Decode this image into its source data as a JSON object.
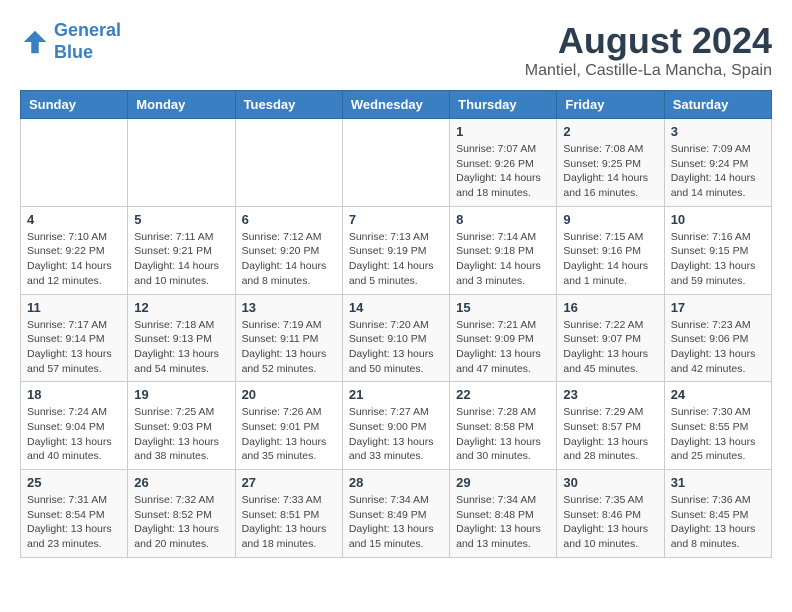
{
  "header": {
    "logo_line1": "General",
    "logo_line2": "Blue",
    "title": "August 2024",
    "subtitle": "Mantiel, Castille-La Mancha, Spain"
  },
  "weekdays": [
    "Sunday",
    "Monday",
    "Tuesday",
    "Wednesday",
    "Thursday",
    "Friday",
    "Saturday"
  ],
  "weeks": [
    [
      {
        "day": "",
        "info": ""
      },
      {
        "day": "",
        "info": ""
      },
      {
        "day": "",
        "info": ""
      },
      {
        "day": "",
        "info": ""
      },
      {
        "day": "1",
        "info": "Sunrise: 7:07 AM\nSunset: 9:26 PM\nDaylight: 14 hours\nand 18 minutes."
      },
      {
        "day": "2",
        "info": "Sunrise: 7:08 AM\nSunset: 9:25 PM\nDaylight: 14 hours\nand 16 minutes."
      },
      {
        "day": "3",
        "info": "Sunrise: 7:09 AM\nSunset: 9:24 PM\nDaylight: 14 hours\nand 14 minutes."
      }
    ],
    [
      {
        "day": "4",
        "info": "Sunrise: 7:10 AM\nSunset: 9:22 PM\nDaylight: 14 hours\nand 12 minutes."
      },
      {
        "day": "5",
        "info": "Sunrise: 7:11 AM\nSunset: 9:21 PM\nDaylight: 14 hours\nand 10 minutes."
      },
      {
        "day": "6",
        "info": "Sunrise: 7:12 AM\nSunset: 9:20 PM\nDaylight: 14 hours\nand 8 minutes."
      },
      {
        "day": "7",
        "info": "Sunrise: 7:13 AM\nSunset: 9:19 PM\nDaylight: 14 hours\nand 5 minutes."
      },
      {
        "day": "8",
        "info": "Sunrise: 7:14 AM\nSunset: 9:18 PM\nDaylight: 14 hours\nand 3 minutes."
      },
      {
        "day": "9",
        "info": "Sunrise: 7:15 AM\nSunset: 9:16 PM\nDaylight: 14 hours\nand 1 minute."
      },
      {
        "day": "10",
        "info": "Sunrise: 7:16 AM\nSunset: 9:15 PM\nDaylight: 13 hours\nand 59 minutes."
      }
    ],
    [
      {
        "day": "11",
        "info": "Sunrise: 7:17 AM\nSunset: 9:14 PM\nDaylight: 13 hours\nand 57 minutes."
      },
      {
        "day": "12",
        "info": "Sunrise: 7:18 AM\nSunset: 9:13 PM\nDaylight: 13 hours\nand 54 minutes."
      },
      {
        "day": "13",
        "info": "Sunrise: 7:19 AM\nSunset: 9:11 PM\nDaylight: 13 hours\nand 52 minutes."
      },
      {
        "day": "14",
        "info": "Sunrise: 7:20 AM\nSunset: 9:10 PM\nDaylight: 13 hours\nand 50 minutes."
      },
      {
        "day": "15",
        "info": "Sunrise: 7:21 AM\nSunset: 9:09 PM\nDaylight: 13 hours\nand 47 minutes."
      },
      {
        "day": "16",
        "info": "Sunrise: 7:22 AM\nSunset: 9:07 PM\nDaylight: 13 hours\nand 45 minutes."
      },
      {
        "day": "17",
        "info": "Sunrise: 7:23 AM\nSunset: 9:06 PM\nDaylight: 13 hours\nand 42 minutes."
      }
    ],
    [
      {
        "day": "18",
        "info": "Sunrise: 7:24 AM\nSunset: 9:04 PM\nDaylight: 13 hours\nand 40 minutes."
      },
      {
        "day": "19",
        "info": "Sunrise: 7:25 AM\nSunset: 9:03 PM\nDaylight: 13 hours\nand 38 minutes."
      },
      {
        "day": "20",
        "info": "Sunrise: 7:26 AM\nSunset: 9:01 PM\nDaylight: 13 hours\nand 35 minutes."
      },
      {
        "day": "21",
        "info": "Sunrise: 7:27 AM\nSunset: 9:00 PM\nDaylight: 13 hours\nand 33 minutes."
      },
      {
        "day": "22",
        "info": "Sunrise: 7:28 AM\nSunset: 8:58 PM\nDaylight: 13 hours\nand 30 minutes."
      },
      {
        "day": "23",
        "info": "Sunrise: 7:29 AM\nSunset: 8:57 PM\nDaylight: 13 hours\nand 28 minutes."
      },
      {
        "day": "24",
        "info": "Sunrise: 7:30 AM\nSunset: 8:55 PM\nDaylight: 13 hours\nand 25 minutes."
      }
    ],
    [
      {
        "day": "25",
        "info": "Sunrise: 7:31 AM\nSunset: 8:54 PM\nDaylight: 13 hours\nand 23 minutes."
      },
      {
        "day": "26",
        "info": "Sunrise: 7:32 AM\nSunset: 8:52 PM\nDaylight: 13 hours\nand 20 minutes."
      },
      {
        "day": "27",
        "info": "Sunrise: 7:33 AM\nSunset: 8:51 PM\nDaylight: 13 hours\nand 18 minutes."
      },
      {
        "day": "28",
        "info": "Sunrise: 7:34 AM\nSunset: 8:49 PM\nDaylight: 13 hours\nand 15 minutes."
      },
      {
        "day": "29",
        "info": "Sunrise: 7:34 AM\nSunset: 8:48 PM\nDaylight: 13 hours\nand 13 minutes."
      },
      {
        "day": "30",
        "info": "Sunrise: 7:35 AM\nSunset: 8:46 PM\nDaylight: 13 hours\nand 10 minutes."
      },
      {
        "day": "31",
        "info": "Sunrise: 7:36 AM\nSunset: 8:45 PM\nDaylight: 13 hours\nand 8 minutes."
      }
    ]
  ]
}
